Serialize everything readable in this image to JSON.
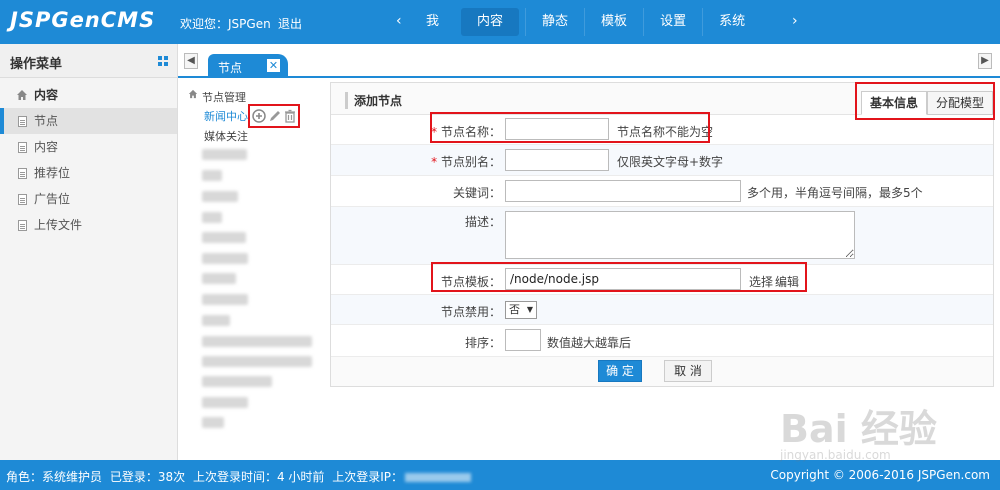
{
  "header": {
    "logo": "JSPGenCMS",
    "welcome": "欢迎您：JSPGen",
    "logout": "退出",
    "prev_icon": "‹",
    "next_icon": "›",
    "nav": [
      "我",
      "内容",
      "静态",
      "模板",
      "设置",
      "系统"
    ],
    "active_nav": "内容"
  },
  "sidebar": {
    "title": "操作菜单",
    "group": "内容",
    "items": [
      "节点",
      "内容",
      "推荐位",
      "广告位",
      "上传文件"
    ],
    "active_item": "节点"
  },
  "tabs": {
    "left_icon": "◀",
    "right_icon": "▶",
    "current": "节点",
    "close_icon": "✕"
  },
  "tree": {
    "root": "节点管理",
    "nodes": [
      "新闻中心",
      "媒体关注"
    ],
    "selected": "新闻中心"
  },
  "form": {
    "title": "添加节点",
    "tabs": [
      "基本信息",
      "分配模型"
    ],
    "active_tab": "基本信息",
    "required_mark": "*",
    "name_label": "节点名称：",
    "name_value": "",
    "name_hint": "节点名称不能为空",
    "alias_label": "节点别名：",
    "alias_value": "",
    "alias_hint": "仅限英文字母+数字",
    "keywords_label": "关键词：",
    "keywords_value": "",
    "keywords_hint": "多个用，半角逗号间隔，最多5个",
    "desc_label": "描述：",
    "desc_value": "",
    "template_label": "节点模板：",
    "template_value": "/node/node.jsp",
    "template_select": "选择",
    "template_edit": "编辑",
    "disable_label": "节点禁用：",
    "disable_value": "否",
    "disable_arrow": "▼",
    "order_label": "排序：",
    "order_value": "",
    "order_hint": "数值越大越靠后",
    "submit": "确 定",
    "cancel": "取 消"
  },
  "footer": {
    "role": "角色：系统维护员",
    "logins": "已登录：38次",
    "last_time": "上次登录时间：4 小时前",
    "last_ip_label": "上次登录IP：",
    "copyright": "Copyright © 2006-2016 JSPGen.com"
  },
  "watermark": {
    "text": "Bai 经验",
    "url": "jingyan.baidu.com"
  },
  "colors": {
    "primary": "#1e8ad6",
    "highlight": "#e2141b"
  }
}
